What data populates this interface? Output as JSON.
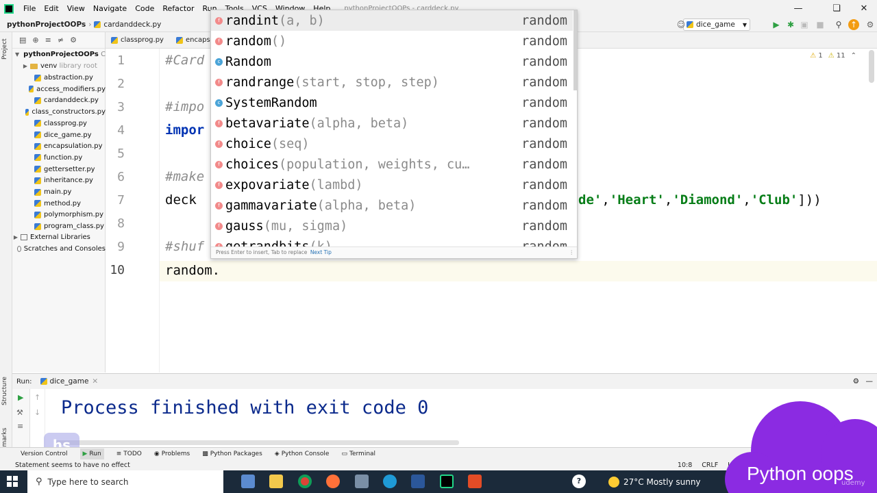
{
  "menubar": {
    "items": [
      "File",
      "Edit",
      "View",
      "Navigate",
      "Code",
      "Refactor",
      "Run",
      "Tools",
      "VCS",
      "Window",
      "Help"
    ],
    "window_title": "pythonProjectOOPs - carddeck.py"
  },
  "navbar": {
    "project": "pythonProjectOOPs",
    "file": "cardanddeck.py",
    "run_config": "dice_game"
  },
  "project_pane": {
    "label": "Project",
    "root": "pythonProjectOOPs",
    "root_suffix": "C",
    "venv": "venv",
    "venv_note": "library root",
    "files": [
      "abstraction.py",
      "access_modifiers.py",
      "cardanddeck.py",
      "class_constructors.py",
      "classprog.py",
      "dice_game.py",
      "encapsulation.py",
      "function.py",
      "gettersetter.py",
      "inheritance.py",
      "main.py",
      "method.py",
      "polymorphism.py",
      "program_class.py"
    ],
    "external": "External Libraries",
    "scratches": "Scratches and Consoles"
  },
  "tabs": [
    "classprog.py",
    "encapsu"
  ],
  "editor": {
    "line_numbers": [
      "1",
      "2",
      "3",
      "4",
      "5",
      "6",
      "7",
      "8",
      "9",
      "10"
    ],
    "line1": "#Card",
    "line3": "#impo",
    "line4": "impor",
    "line6": "#make",
    "line7_start": "deck",
    "line7_end_a": "de'",
    "line7_comma1": ",",
    "line7_heart": "'Heart'",
    "line7_comma2": ",",
    "line7_diamond": "'Diamond'",
    "line7_comma3": ",",
    "line7_club": "'Club'",
    "line7_close": "]))",
    "line9": "#shuf",
    "line10": "random."
  },
  "inspections": {
    "warnings": "1",
    "weak": "11"
  },
  "completion": {
    "items": [
      {
        "kind": "f",
        "name": "randint",
        "args": "(a, b)",
        "module": "random"
      },
      {
        "kind": "f",
        "name": "random",
        "args": "()",
        "module": "random"
      },
      {
        "kind": "c",
        "name": "Random",
        "args": "",
        "module": "random"
      },
      {
        "kind": "f",
        "name": "randrange",
        "args": "(start, stop, step)",
        "module": "random"
      },
      {
        "kind": "c",
        "name": "SystemRandom",
        "args": "",
        "module": "random"
      },
      {
        "kind": "f",
        "name": "betavariate",
        "args": "(alpha, beta)",
        "module": "random"
      },
      {
        "kind": "f",
        "name": "choice",
        "args": "(seq)",
        "module": "random"
      },
      {
        "kind": "f",
        "name": "choices",
        "args": "(population, weights, cu…",
        "module": "random"
      },
      {
        "kind": "f",
        "name": "expovariate",
        "args": "(lambd)",
        "module": "random"
      },
      {
        "kind": "f",
        "name": "gammavariate",
        "args": "(alpha, beta)",
        "module": "random"
      },
      {
        "kind": "f",
        "name": "gauss",
        "args": "(mu, sigma)",
        "module": "random"
      },
      {
        "kind": "f",
        "name": "getrandbits",
        "args": "(k)",
        "module": "random"
      }
    ],
    "footer": "Press Enter to insert, Tab to replace",
    "next_tip": "Next Tip"
  },
  "run_panel": {
    "label": "Run:",
    "tab": "dice_game",
    "output": "Process finished with exit code 0"
  },
  "tool_tabs": [
    "Version Control",
    "Run",
    "TODO",
    "Problems",
    "Python Packages",
    "Python Console",
    "Terminal"
  ],
  "left_strip": {
    "structure": "Structure",
    "bookmarks": "Bookmarks"
  },
  "status": {
    "message": "Statement seems to have no effect",
    "position": "10:8",
    "line_sep": "CRLF",
    "encoding": "UTF-8",
    "indent": "4"
  },
  "taskbar": {
    "search_placeholder": "Type here to search",
    "weather": "27°C  Mostly sunny"
  },
  "watermark": {
    "text": "Python oops",
    "logo": "hs",
    "site": "udemy"
  },
  "colors": {
    "keyword": "#0033b3",
    "string": "#067d17",
    "comment": "#8c8c8c",
    "output": "#0b2a8c",
    "watermark": "#8b2be2"
  }
}
